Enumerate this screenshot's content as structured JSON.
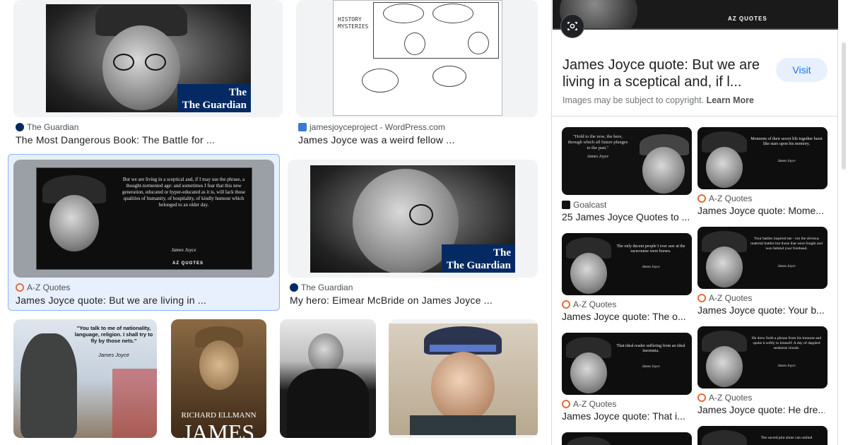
{
  "results": [
    {
      "source": "The Guardian",
      "caption": "The Most Dangerous Book: The Battle for ...",
      "logo": "The Guardian"
    },
    {
      "source": "jamesjoyceproject - WordPress.com",
      "caption": "James Joyce was a weird fellow ...",
      "comic_text": "HISTORY MYSTERIES"
    },
    {
      "source": "A-Z Quotes",
      "caption": "James Joyce quote: But we are living in ...",
      "quote": "But we are living in a sceptical and, if I may use the phrase, a thought-tormented age: and sometimes I fear that this new generation, educated or hyper-educated as it is, will lack those qualities of humanity, of hospitality, of kindly humour which belonged to an older day.",
      "attribution": "James Joyce",
      "brand": "AZ QUOTES"
    },
    {
      "source": "The Guardian",
      "caption": "My hero: Eimear McBride on James Joyce ...",
      "logo": "The Guardian"
    },
    {
      "quote": "\"You talk to me of nationality, language, religion. I shall try to fly by those nets.\"",
      "attribution": "James Joyce"
    },
    {
      "book_author": "RICHARD ELLMANN",
      "book_title": "JAMES"
    },
    {},
    {}
  ],
  "preview": {
    "brand": "AZ QUOTES",
    "title": "James Joyce quote: But we are living in a sceptical and, if l...",
    "visit": "Visit",
    "copyright": "Images may be subject to copyright.",
    "learn_more": "Learn More"
  },
  "related": [
    {
      "source": "Goalcast",
      "caption": "25 James Joyce Quotes to ...",
      "quote": "\"Hold to the now, the here, through which all future plunges to the past.\"",
      "attribution": "James Joyce"
    },
    {
      "source": "A-Z Quotes",
      "caption": "James Joyce quote: Mome...",
      "quote": "Moments of their secret life together burst like stars upon his memory.",
      "attribution": "James Joyce"
    },
    {
      "source": "A-Z Quotes",
      "caption": "James Joyce quote: The o...",
      "quote": "The only decent people I ever saw at the racecourse were horses.",
      "attribution": "James Joyce"
    },
    {
      "source": "A-Z Quotes",
      "caption": "James Joyce quote: Your b...",
      "quote": "Your battles inspired me - not the obvious material battles but those that were fought and won behind your forehead.",
      "attribution": "James Joyce"
    },
    {
      "source": "A-Z Quotes",
      "caption": "James Joyce quote: That i...",
      "quote": "That ideal reader suffering from an ideal insomnia.",
      "attribution": "James Joyce"
    },
    {
      "source": "A-Z Quotes",
      "caption": "James Joyce quote: He dre...",
      "quote": "He drew forth a phrase from his treasure and spoke it softly to himself: A day of dappled seaborne clouds.",
      "attribution": "James Joyce"
    },
    {
      "quote": "The sacred pint alone can unbind"
    }
  ],
  "icons": {
    "lens": "lens-camera-icon"
  }
}
